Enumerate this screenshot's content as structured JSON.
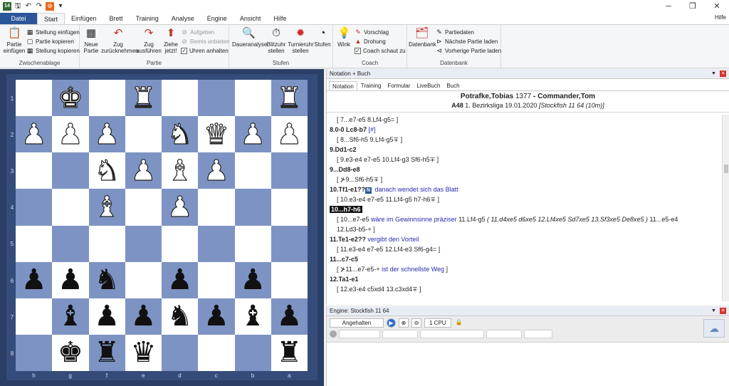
{
  "quick_access": [
    "app-icon",
    "save-icon",
    "undo-icon",
    "redo-icon",
    "engine-icon",
    "dropdown-icon"
  ],
  "window_controls": [
    "─",
    "❐",
    "✕"
  ],
  "menu": {
    "file": "Datei",
    "tabs": [
      "Start",
      "Einfügen",
      "Brett",
      "Training",
      "Analyse",
      "Engine",
      "Ansicht",
      "Hilfe"
    ],
    "help_link": "Hilfe"
  },
  "ribbon": {
    "clipboard": {
      "label": "Zwischenablage",
      "paste": "Partie einfügen",
      "items": [
        "Stellung einfügen",
        "Partie kopieren",
        "Stellung kopieren"
      ]
    },
    "game": {
      "label": "Partie",
      "new_game": "Neue Partie",
      "take_back": "Zug zurücknehmen",
      "forward": "Zug ausführen",
      "move_now": "Ziehe jetzt!",
      "resign": "Aufgeben",
      "offer_draw": "Remis anbieten",
      "stop_clocks": "Uhren anhalten"
    },
    "levels": {
      "label": "Stufen",
      "infinite": "Daueranalyse",
      "blitz": "Blitzuhr stellen",
      "tournament": "Turnieruhr stellen",
      "levels": "Stufen"
    },
    "coach": {
      "label": "Coach",
      "hint": "Wink",
      "suggestion": "Vorschlag",
      "threat": "Drohung",
      "coach_watches": "Coach schaut zu"
    },
    "database": {
      "label": "Datenbank",
      "database": "Datenbank",
      "game_data": "Partiedaten",
      "next_game": "Nächste Partie laden",
      "prev_game": "Vorherige Partie laden"
    }
  },
  "board": {
    "ranks": [
      "1",
      "2",
      "3",
      "4",
      "5",
      "6",
      "7",
      "8"
    ],
    "files": [
      "h",
      "g",
      "f",
      "e",
      "d",
      "c",
      "b",
      "a"
    ],
    "squares": [
      [
        "",
        "wK",
        "",
        "wR",
        "",
        "",
        "",
        "wR"
      ],
      [
        "wP",
        "wP",
        "wP",
        "",
        "wN",
        "wQ",
        "wP",
        "wP"
      ],
      [
        "",
        "",
        "wN",
        "wP",
        "wB",
        "wP",
        "",
        ""
      ],
      [
        "",
        "",
        "wB",
        "",
        "wP",
        "",
        "",
        ""
      ],
      [
        "",
        "",
        "",
        "",
        "",
        "",
        "",
        ""
      ],
      [
        "bP",
        "bP",
        "bN",
        "",
        "bP",
        "",
        "bP",
        ""
      ],
      [
        "",
        "bB",
        "bP",
        "bP",
        "bN",
        "bP",
        "bB",
        "bP"
      ],
      [
        "",
        "bK",
        "bR",
        "bQ",
        "",
        "",
        "",
        "bR"
      ]
    ]
  },
  "notation_panel": {
    "title": "Notation + Buch",
    "tabs": [
      "Notation",
      "Training",
      "Formular",
      "LiveBuch",
      "Buch"
    ],
    "header": {
      "white": "Potrafke,Tobias",
      "white_elo": "1377",
      "separator": " - ",
      "black": "Commander,Tom",
      "eco": "A48",
      "event_line": " 1. Bezirksliga 19.01.2020 ",
      "engine_note": "[Stockfish 11 64 (10m)]"
    },
    "lines": [
      {
        "type": "var",
        "text": "[ 7...e7-e5  8.Lf4-g5= ]"
      },
      {
        "type": "main",
        "text": "8.0-0",
        "rest": "  Lc8-b7 ",
        "cmt": "[#]"
      },
      {
        "type": "var",
        "text": "[ 8...Sf6-h5  9.Lf4-g5∓ ]"
      },
      {
        "type": "main",
        "text": "9.Dd1-c2"
      },
      {
        "type": "var",
        "text": "[ 9.e3-e4  e7-e5  10.Lf4-g3  Sf6-h5∓ ]"
      },
      {
        "type": "main",
        "text": "9...Dd8-e8"
      },
      {
        "type": "var",
        "text": "[ ⊁9...Sf6-h5∓ ]"
      },
      {
        "type": "main",
        "text": "10.Tf1-e1??",
        "cmt": "danach wendet sich das Blatt",
        "icon": "N"
      },
      {
        "type": "var",
        "text": "[ 10.e3-e4  e7-e5  11.Lf4-g5  h7-h6∓ ]"
      },
      {
        "type": "current",
        "text": "10...h7-h6"
      },
      {
        "type": "var",
        "text": "[ 10...e7-e5 ",
        "cmt": "wäre im Gewinnsinne präziser",
        "rest": "  11.Lf4-g5  ",
        "it": "( 11.d4xe5  d6xe5  12.Lf4xe5  Sd7xe5  13.Sf3xe5  De8xe5 )",
        "tail": " 11...e5-e4"
      },
      {
        "type": "var",
        "text": "12.Ld3-b5-+ ]"
      },
      {
        "type": "main",
        "text": "11.Te1-e2??",
        "cmt": "vergibt den Vorteil"
      },
      {
        "type": "var",
        "text": "[ 11.e3-e4  e7-e5  12.Lf4-e3  Sf6-g4= ]"
      },
      {
        "type": "main",
        "text": "11...c7-c5"
      },
      {
        "type": "var",
        "text": "[ ⊁11...e7-e5-+ ",
        "cmt": "ist der schnellste Weg",
        "tail": " ]"
      },
      {
        "type": "main",
        "text": "12.Ta1-e1"
      },
      {
        "type": "var",
        "text": "[ 12.e3-e4  c5xd4  13.c3xd4∓ ]"
      }
    ]
  },
  "engine_panel": {
    "title": "Engine: Stockfish 11 64",
    "stopped": "Angehalten",
    "cpu": "1 CPU"
  },
  "colors": {
    "light_square": "#ffffff",
    "dark_square": "#7d93c3",
    "file_tab": "#2b579a",
    "comment": "#2a2ab0"
  }
}
